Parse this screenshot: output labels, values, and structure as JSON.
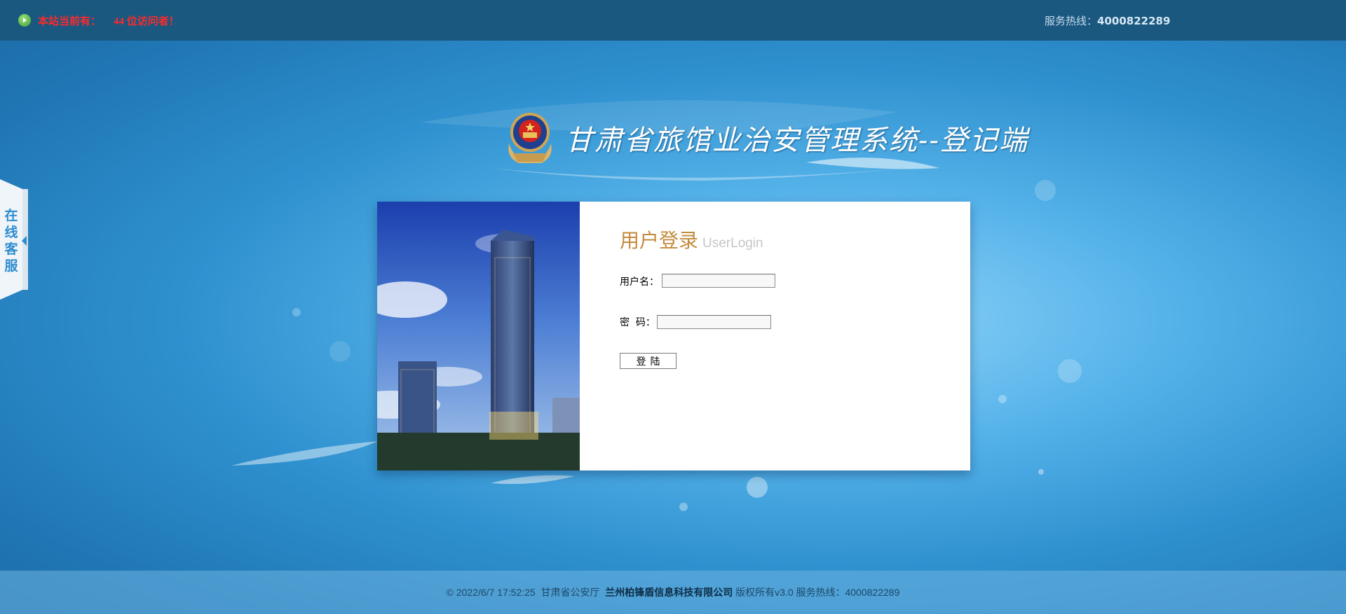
{
  "header": {
    "visitor_prefix": "本站当前有：",
    "visitor_count": "44 位访问者！",
    "hotline_label": "服务热线：",
    "hotline_number": "4000822289"
  },
  "title": {
    "text": "甘肃省旅馆业治安管理系统--登记端"
  },
  "side_service": {
    "label": "在线客服"
  },
  "login": {
    "title_cn": "用户登录",
    "title_en": "UserLogin",
    "username_label": "用户名：",
    "username_value": "",
    "password_label": "密  码：",
    "password_value": "",
    "submit_label": "登陆"
  },
  "footer": {
    "copyright": "© 2022/6/7 17:52:25  甘肃省公安厅  ",
    "company": "兰州柏锋盾信息科技有限公司",
    "rights": " 版权所有v3.0 服务热线：4000822289"
  },
  "colors": {
    "topbar": "#1a5880",
    "visitor_text": "#ff2a2a",
    "login_title": "#c48a3c"
  }
}
